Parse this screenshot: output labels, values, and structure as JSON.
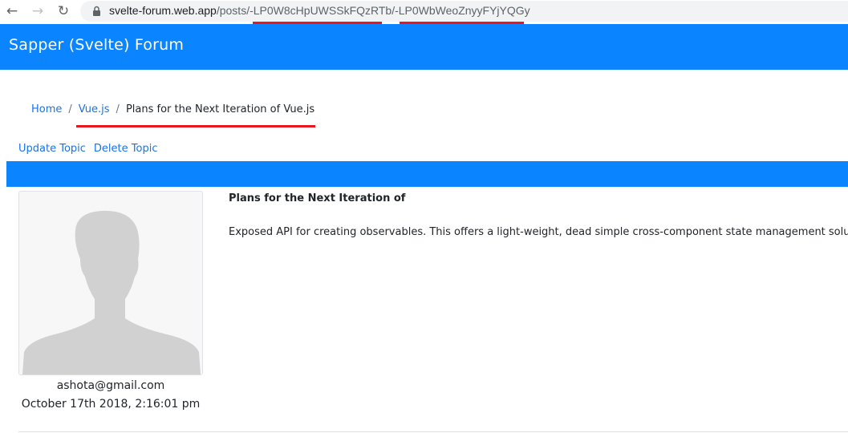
{
  "browser": {
    "back_icon": "←",
    "forward_icon": "→",
    "reload_icon": "↻",
    "url_host": "svelte-forum.web.app",
    "url_path_prefix": "/posts/",
    "url_id_1": "-LP0W8cHpUWSSkFQzRTb",
    "url_sep": "/",
    "url_id_2": "-LP0WbWeoZnyyFYjYQGy",
    "highlight_color": "#e8161e"
  },
  "navbar": {
    "brand": "Sapper (Svelte)  Forum",
    "color": "#0b84ff"
  },
  "breadcrumb": {
    "home": "Home",
    "category": "Vue.js",
    "current": "Plans for the Next Iteration of Vue.js",
    "separator": "/"
  },
  "topic_actions": {
    "update": "Update Topic",
    "delete": "Delete Topic"
  },
  "post": {
    "title": "Plans for the Next Iteration of",
    "body": "Exposed API for creating observables. This offers a light-weight, dead simple cross-component state management solution for small to medium scale scenarios.",
    "author_email": "ashota@gmail.com",
    "date": "October 17th 2018, 2:16:01 pm",
    "avatar_icon": "default-user-silhouette"
  }
}
